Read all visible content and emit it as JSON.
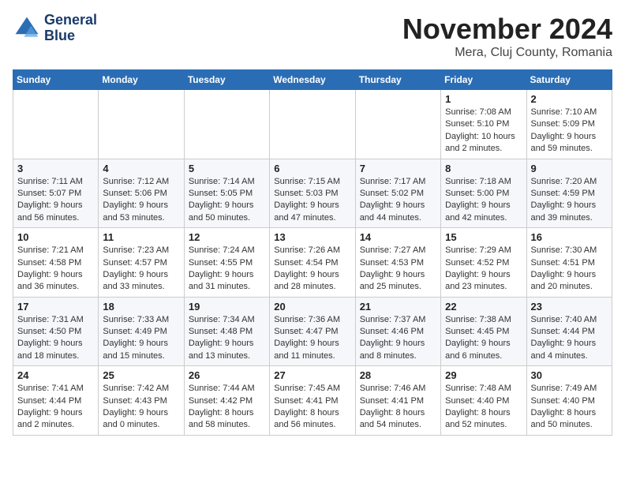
{
  "header": {
    "logo_line1": "General",
    "logo_line2": "Blue",
    "month": "November 2024",
    "location": "Mera, Cluj County, Romania"
  },
  "weekdays": [
    "Sunday",
    "Monday",
    "Tuesday",
    "Wednesday",
    "Thursday",
    "Friday",
    "Saturday"
  ],
  "weeks": [
    [
      {
        "day": "",
        "info": ""
      },
      {
        "day": "",
        "info": ""
      },
      {
        "day": "",
        "info": ""
      },
      {
        "day": "",
        "info": ""
      },
      {
        "day": "",
        "info": ""
      },
      {
        "day": "1",
        "info": "Sunrise: 7:08 AM\nSunset: 5:10 PM\nDaylight: 10 hours and 2 minutes."
      },
      {
        "day": "2",
        "info": "Sunrise: 7:10 AM\nSunset: 5:09 PM\nDaylight: 9 hours and 59 minutes."
      }
    ],
    [
      {
        "day": "3",
        "info": "Sunrise: 7:11 AM\nSunset: 5:07 PM\nDaylight: 9 hours and 56 minutes."
      },
      {
        "day": "4",
        "info": "Sunrise: 7:12 AM\nSunset: 5:06 PM\nDaylight: 9 hours and 53 minutes."
      },
      {
        "day": "5",
        "info": "Sunrise: 7:14 AM\nSunset: 5:05 PM\nDaylight: 9 hours and 50 minutes."
      },
      {
        "day": "6",
        "info": "Sunrise: 7:15 AM\nSunset: 5:03 PM\nDaylight: 9 hours and 47 minutes."
      },
      {
        "day": "7",
        "info": "Sunrise: 7:17 AM\nSunset: 5:02 PM\nDaylight: 9 hours and 44 minutes."
      },
      {
        "day": "8",
        "info": "Sunrise: 7:18 AM\nSunset: 5:00 PM\nDaylight: 9 hours and 42 minutes."
      },
      {
        "day": "9",
        "info": "Sunrise: 7:20 AM\nSunset: 4:59 PM\nDaylight: 9 hours and 39 minutes."
      }
    ],
    [
      {
        "day": "10",
        "info": "Sunrise: 7:21 AM\nSunset: 4:58 PM\nDaylight: 9 hours and 36 minutes."
      },
      {
        "day": "11",
        "info": "Sunrise: 7:23 AM\nSunset: 4:57 PM\nDaylight: 9 hours and 33 minutes."
      },
      {
        "day": "12",
        "info": "Sunrise: 7:24 AM\nSunset: 4:55 PM\nDaylight: 9 hours and 31 minutes."
      },
      {
        "day": "13",
        "info": "Sunrise: 7:26 AM\nSunset: 4:54 PM\nDaylight: 9 hours and 28 minutes."
      },
      {
        "day": "14",
        "info": "Sunrise: 7:27 AM\nSunset: 4:53 PM\nDaylight: 9 hours and 25 minutes."
      },
      {
        "day": "15",
        "info": "Sunrise: 7:29 AM\nSunset: 4:52 PM\nDaylight: 9 hours and 23 minutes."
      },
      {
        "day": "16",
        "info": "Sunrise: 7:30 AM\nSunset: 4:51 PM\nDaylight: 9 hours and 20 minutes."
      }
    ],
    [
      {
        "day": "17",
        "info": "Sunrise: 7:31 AM\nSunset: 4:50 PM\nDaylight: 9 hours and 18 minutes."
      },
      {
        "day": "18",
        "info": "Sunrise: 7:33 AM\nSunset: 4:49 PM\nDaylight: 9 hours and 15 minutes."
      },
      {
        "day": "19",
        "info": "Sunrise: 7:34 AM\nSunset: 4:48 PM\nDaylight: 9 hours and 13 minutes."
      },
      {
        "day": "20",
        "info": "Sunrise: 7:36 AM\nSunset: 4:47 PM\nDaylight: 9 hours and 11 minutes."
      },
      {
        "day": "21",
        "info": "Sunrise: 7:37 AM\nSunset: 4:46 PM\nDaylight: 9 hours and 8 minutes."
      },
      {
        "day": "22",
        "info": "Sunrise: 7:38 AM\nSunset: 4:45 PM\nDaylight: 9 hours and 6 minutes."
      },
      {
        "day": "23",
        "info": "Sunrise: 7:40 AM\nSunset: 4:44 PM\nDaylight: 9 hours and 4 minutes."
      }
    ],
    [
      {
        "day": "24",
        "info": "Sunrise: 7:41 AM\nSunset: 4:44 PM\nDaylight: 9 hours and 2 minutes."
      },
      {
        "day": "25",
        "info": "Sunrise: 7:42 AM\nSunset: 4:43 PM\nDaylight: 9 hours and 0 minutes."
      },
      {
        "day": "26",
        "info": "Sunrise: 7:44 AM\nSunset: 4:42 PM\nDaylight: 8 hours and 58 minutes."
      },
      {
        "day": "27",
        "info": "Sunrise: 7:45 AM\nSunset: 4:41 PM\nDaylight: 8 hours and 56 minutes."
      },
      {
        "day": "28",
        "info": "Sunrise: 7:46 AM\nSunset: 4:41 PM\nDaylight: 8 hours and 54 minutes."
      },
      {
        "day": "29",
        "info": "Sunrise: 7:48 AM\nSunset: 4:40 PM\nDaylight: 8 hours and 52 minutes."
      },
      {
        "day": "30",
        "info": "Sunrise: 7:49 AM\nSunset: 4:40 PM\nDaylight: 8 hours and 50 minutes."
      }
    ]
  ]
}
